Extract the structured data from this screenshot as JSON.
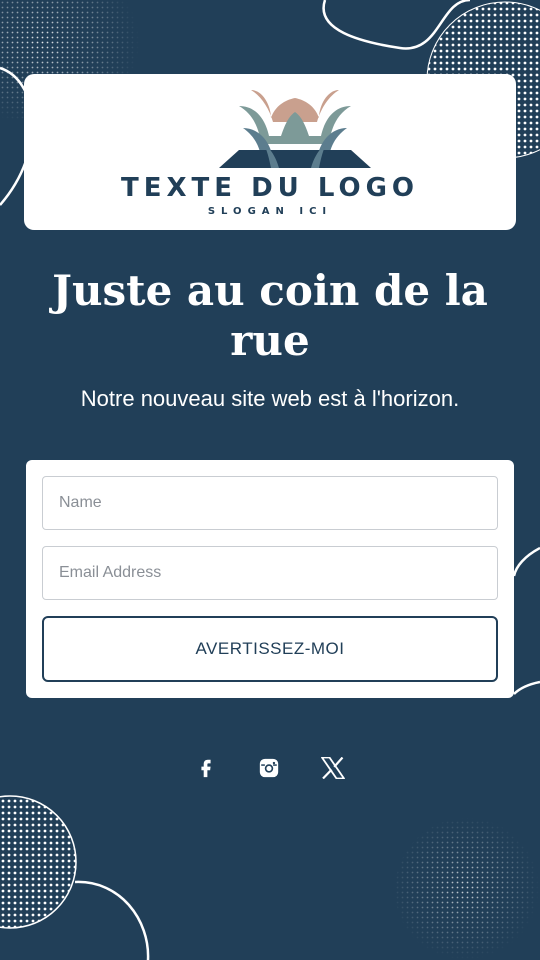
{
  "brand": {
    "logo_text": "TEXTE DU LOGO",
    "slogan": "SLOGAN ICI",
    "colors": {
      "background": "#213f58",
      "logo_rose": "#c9a08e",
      "logo_sage": "#7d9a98",
      "logo_slate": "#5c7d8e",
      "logo_navy": "#213f58"
    }
  },
  "hero": {
    "headline": "Juste au coin de la rue",
    "subtitle": "Notre nouveau site web est à l'horizon."
  },
  "form": {
    "name_placeholder": "Name",
    "email_placeholder": "Email Address",
    "submit_label": "AVERTISSEZ-MOI"
  },
  "social": {
    "icons": [
      "facebook-icon",
      "instagram-icon",
      "x-icon"
    ]
  }
}
